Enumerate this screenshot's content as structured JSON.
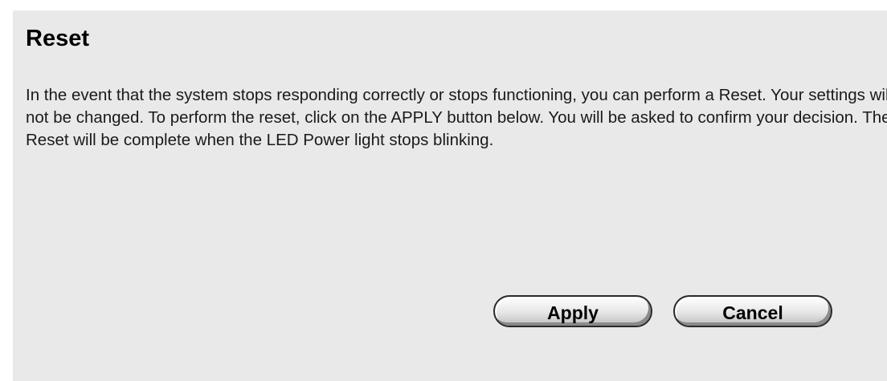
{
  "page": {
    "title": "Reset",
    "description": "In the event that the system stops responding correctly or stops functioning, you can perform a Reset. Your settings will not be changed. To perform the reset, click on the APPLY button below. You will be asked to confirm your decision. The Reset will be complete when the LED Power light stops blinking."
  },
  "buttons": {
    "apply_label": "Apply",
    "cancel_label": "Cancel"
  },
  "colors": {
    "panel_background": "#e9e9e9",
    "text": "#000000"
  }
}
